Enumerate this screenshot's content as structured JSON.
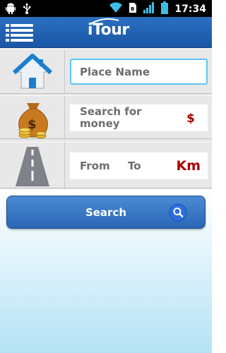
{
  "status_bar": {
    "time": "17:34",
    "icons": [
      "android-icon",
      "usb-icon",
      "wifi-icon",
      "sim-icon",
      "signal-icon",
      "battery-icon"
    ]
  },
  "header": {
    "logo": "iTour",
    "menu_icon": "menu-icon"
  },
  "form": {
    "place": {
      "icon": "house-icon",
      "placeholder": "Place Name"
    },
    "money": {
      "icon": "money-bag-icon",
      "label": "Search for money",
      "unit": "$"
    },
    "distance": {
      "icon": "road-icon",
      "from_label": "From",
      "to_label": "To",
      "unit": "Km"
    }
  },
  "search_button": {
    "label": "Search",
    "icon": "magnifier-icon"
  },
  "colors": {
    "header_blue": "#1f5fae",
    "accent_red": "#a80000",
    "input_focus": "#5bc6f2",
    "button_blue": "#3a78c6"
  }
}
